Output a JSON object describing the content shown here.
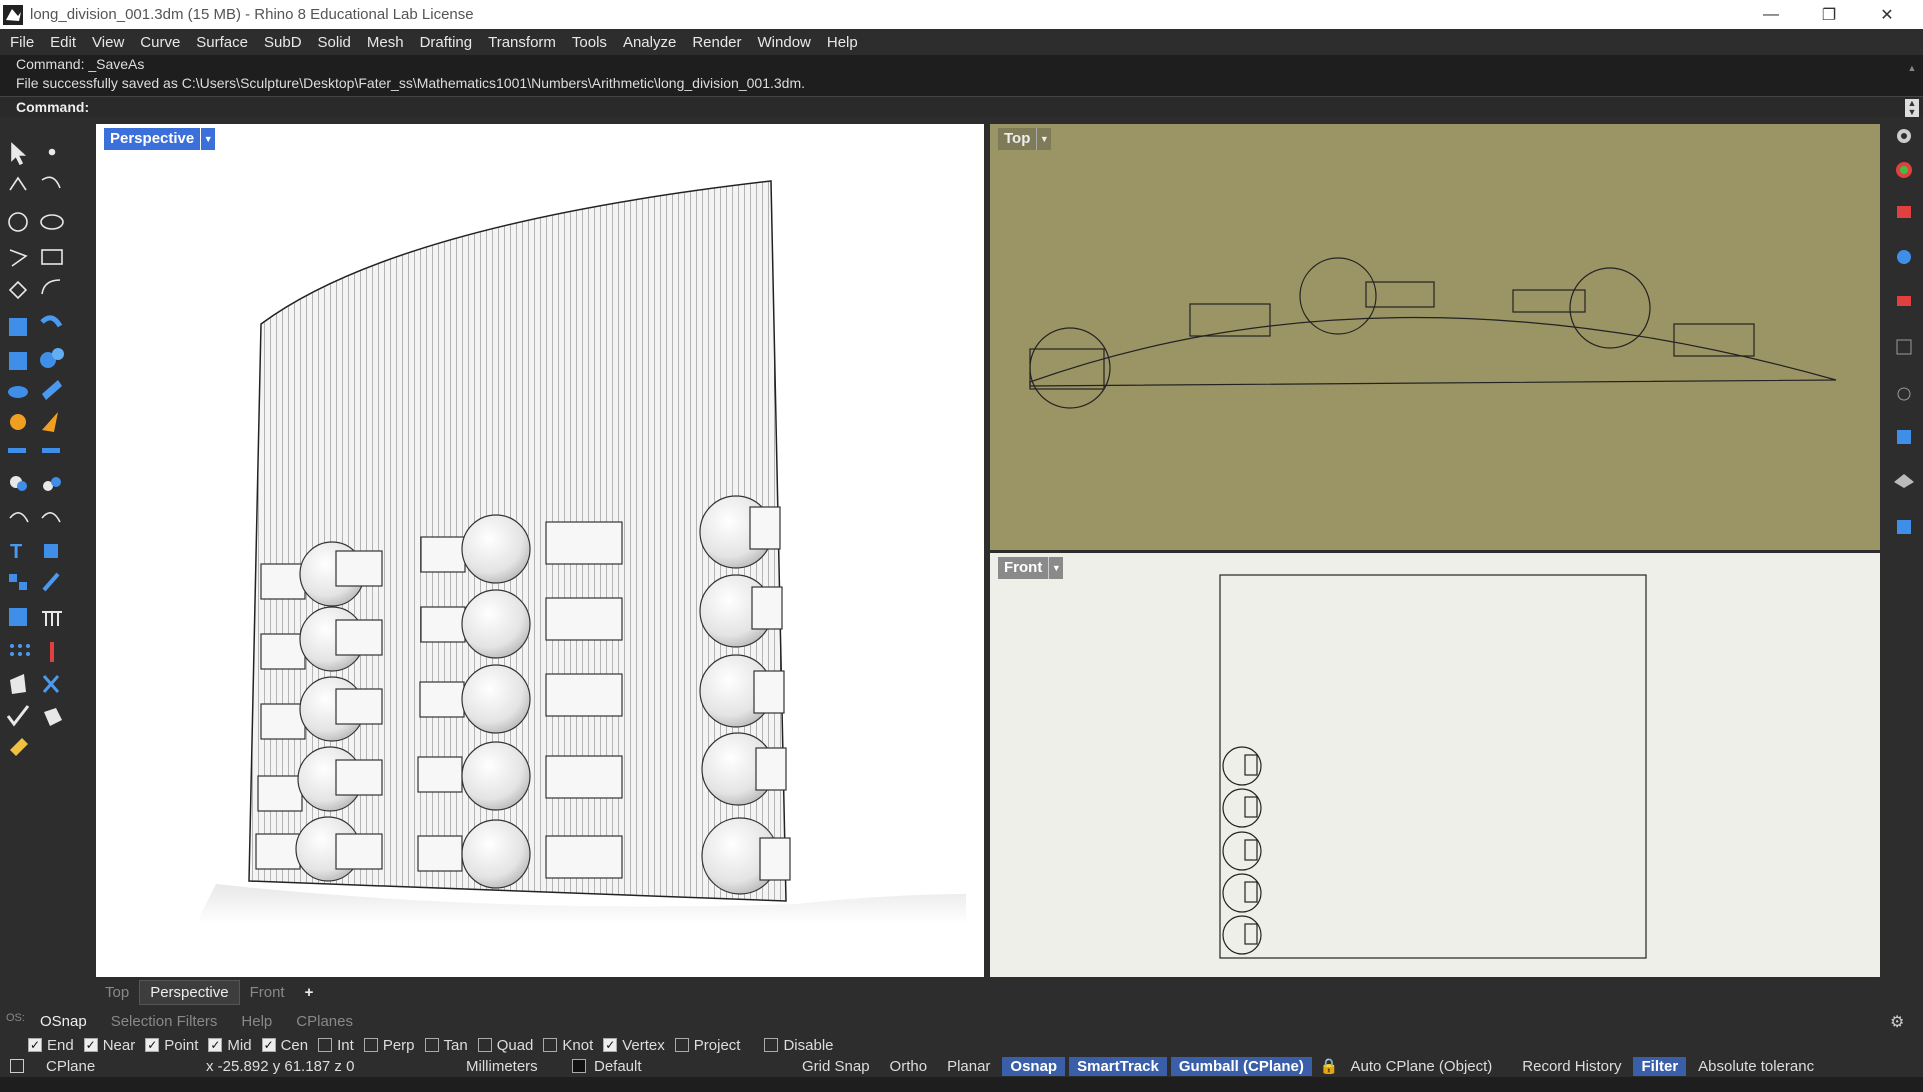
{
  "window": {
    "title": "long_division_001.3dm (15 MB) - Rhino 8 Educational Lab License",
    "minimize": "—",
    "restore": "❐",
    "close": "✕"
  },
  "menu": [
    "File",
    "Edit",
    "View",
    "Curve",
    "Surface",
    "SubD",
    "Solid",
    "Mesh",
    "Drafting",
    "Transform",
    "Tools",
    "Analyze",
    "Render",
    "Window",
    "Help"
  ],
  "command_history": {
    "line1": "Command: _SaveAs",
    "line2": "File successfully saved as C:\\Users\\Sculpture\\Desktop\\Fater_ss\\Mathematics1001\\Numbers\\Arithmetic\\long_division_001.3dm."
  },
  "command_prompt": "Command:",
  "viewports": {
    "perspective": {
      "label": "Perspective",
      "bg": "#ffffff",
      "label_bg": "#3b6fd9"
    },
    "top": {
      "label": "Top",
      "bg": "#9b9465",
      "label_bg": "#7f7a57"
    },
    "front": {
      "label": "Front",
      "bg": "#efefea",
      "label_bg": "#8a8a8a"
    }
  },
  "view_tabs": [
    "Top",
    "Perspective",
    "Front",
    "+"
  ],
  "active_view_tab": "Perspective",
  "panel_tabs": [
    "OSnap",
    "Selection Filters",
    "Help",
    "CPlanes"
  ],
  "osnap": [
    {
      "label": "End",
      "checked": true
    },
    {
      "label": "Near",
      "checked": true
    },
    {
      "label": "Point",
      "checked": true
    },
    {
      "label": "Mid",
      "checked": true
    },
    {
      "label": "Cen",
      "checked": true
    },
    {
      "label": "Int",
      "checked": false
    },
    {
      "label": "Perp",
      "checked": false
    },
    {
      "label": "Tan",
      "checked": false
    },
    {
      "label": "Quad",
      "checked": false
    },
    {
      "label": "Knot",
      "checked": false
    },
    {
      "label": "Vertex",
      "checked": true
    },
    {
      "label": "Project",
      "checked": false
    },
    {
      "label": "Disable",
      "checked": false
    }
  ],
  "status": {
    "cplane": "CPlane",
    "coords": "x -25.892   y 61.187   z 0",
    "units": "Millimeters",
    "layer": "Default",
    "grid_snap": "Grid Snap",
    "ortho": "Ortho",
    "planar": "Planar",
    "osnap": "Osnap",
    "smarttrack": "SmartTrack",
    "gumball": "Gumball (CPlane)",
    "auto_cplane": "Auto CPlane (Object)",
    "record_history": "Record History",
    "filter": "Filter",
    "tolerance": "Absolute toleranc"
  },
  "os_label": "OS:"
}
